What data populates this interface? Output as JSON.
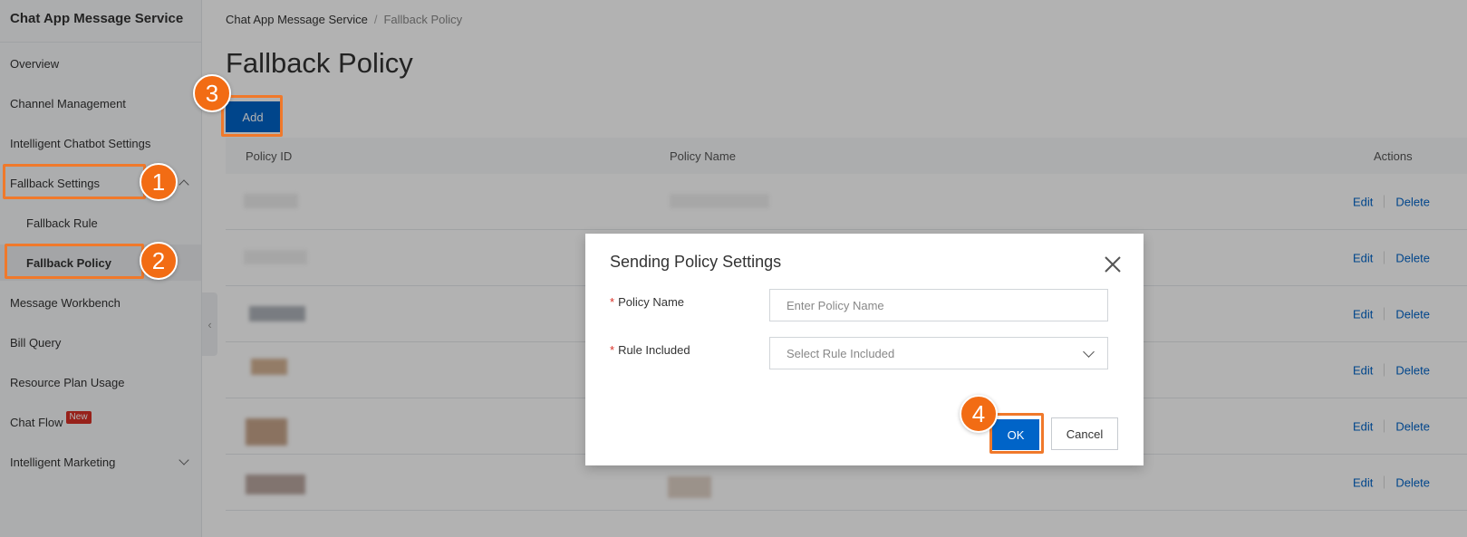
{
  "sidebar": {
    "title": "Chat App Message Service",
    "items": [
      {
        "label": "Overview"
      },
      {
        "label": "Channel Management"
      },
      {
        "label": "Intelligent Chatbot Settings"
      },
      {
        "label": "Fallback Settings"
      },
      {
        "label": "Fallback Rule"
      },
      {
        "label": "Fallback Policy"
      },
      {
        "label": "Message Workbench"
      },
      {
        "label": "Bill Query"
      },
      {
        "label": "Resource Plan Usage"
      },
      {
        "label": "Chat Flow",
        "badge": "New"
      },
      {
        "label": "Intelligent Marketing"
      }
    ]
  },
  "breadcrumb": {
    "root": "Chat App Message Service",
    "separator": "/",
    "current": "Fallback Policy"
  },
  "page": {
    "title": "Fallback Policy",
    "add_label": "Add"
  },
  "table": {
    "columns": [
      "Policy ID",
      "Policy Name",
      "Actions"
    ],
    "edit_label": "Edit",
    "delete_label": "Delete",
    "row_count": 6
  },
  "modal": {
    "title": "Sending Policy Settings",
    "policy_name_label": "Policy Name",
    "policy_name_placeholder": "Enter Policy Name",
    "rule_label": "Rule Included",
    "rule_placeholder": "Select Rule Included",
    "required_mark": "*",
    "ok_label": "OK",
    "cancel_label": "Cancel"
  },
  "annotations": {
    "steps": [
      "1",
      "2",
      "3",
      "4"
    ],
    "highlight_color": "#f0792b"
  },
  "colors": {
    "primary": "#0064c8",
    "danger": "#d93026",
    "step_badge": "#f26c14"
  }
}
